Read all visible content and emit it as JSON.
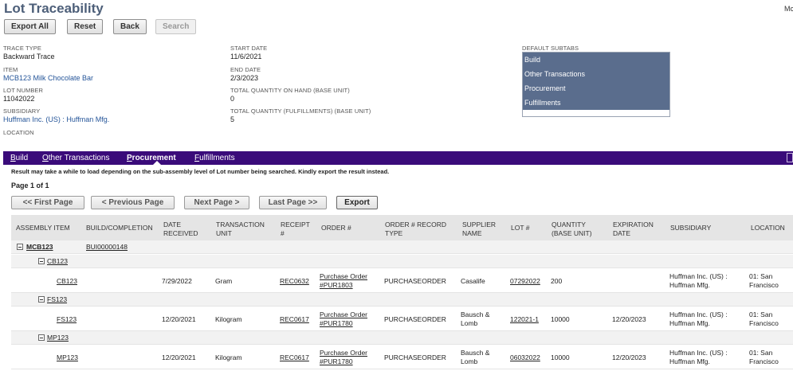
{
  "page": {
    "title": "Lot Traceability",
    "user_badge": "Mc"
  },
  "toolbar": {
    "export_all": "Export All",
    "reset": "Reset",
    "back": "Back",
    "search": "Search"
  },
  "fields": {
    "trace_type": {
      "label": "TRACE TYPE",
      "value": "Backward Trace"
    },
    "item": {
      "label": "ITEM",
      "value": "MCB123 Milk Chocolate Bar"
    },
    "lot_number": {
      "label": "LOT NUMBER",
      "value": "11042022"
    },
    "subsidiary": {
      "label": "SUBSIDIARY",
      "value": "Huffman Inc. (US) : Huffman Mfg."
    },
    "location": {
      "label": "LOCATION",
      "value": ""
    },
    "start_date": {
      "label": "START DATE",
      "value": "11/6/2021"
    },
    "end_date": {
      "label": "END DATE",
      "value": "2/3/2023"
    },
    "qty_on_hand": {
      "label": "TOTAL QUANTITY ON HAND (BASE UNIT)",
      "value": "0"
    },
    "qty_fulfillments": {
      "label": "TOTAL QUANTITY (FULFILLMENTS) (BASE UNIT)",
      "value": "5"
    }
  },
  "default_subtabs": {
    "label": "DEFAULT SUBTABS",
    "options": [
      "Build",
      "Other Transactions",
      "Procurement",
      "Fulfillments"
    ]
  },
  "tabs": [
    {
      "key": "B",
      "rest": "uild"
    },
    {
      "key": "O",
      "rest": "ther Transactions"
    },
    {
      "key": "P",
      "rest": "rocurement"
    },
    {
      "key": "F",
      "rest": "ulfillments"
    }
  ],
  "notice": "Result may take a while to load depending on the sub-assembly level of Lot number being searched. Kindly export the result instead.",
  "pagination": {
    "info": "Page 1 of 1",
    "first": "<< First Page",
    "previous": "< Previous Page",
    "next": "Next Page >",
    "last": "Last Page >>",
    "export": "Export"
  },
  "table": {
    "headers": {
      "assembly_item": "ASSEMBLY ITEM",
      "build_completion": "BUILD/COMPLETION",
      "date_received_1": "DATE",
      "date_received_2": "RECEIVED",
      "transaction_unit_1": "TRANSACTION",
      "transaction_unit_2": "UNIT",
      "receipt_1": "RECEIPT",
      "receipt_2": "#",
      "order": "ORDER #",
      "order_record_type_1": "ORDER # RECORD",
      "order_record_type_2": "TYPE",
      "supplier_name_1": "SUPPLIER",
      "supplier_name_2": "NAME",
      "lot": "LOT #",
      "quantity_1": "QUANTITY",
      "quantity_2": "(BASE UNIT)",
      "expiration_1": "EXPIRATION",
      "expiration_2": "DATE",
      "subsidiary": "SUBSIDIARY",
      "location": "LOCATION"
    },
    "top_row": {
      "assembly_item": "MCB123",
      "build_completion": "BUI00000148"
    },
    "groups": [
      {
        "name": "CB123",
        "row": {
          "item": "CB123",
          "date": "7/29/2022",
          "unit": "Gram",
          "receipt": "REC0632",
          "order_1": "Purchase Order",
          "order_2": "#PUR1803",
          "record_type": "PURCHASEORDER",
          "supplier_1": "Casalife",
          "supplier_2": "",
          "lot": "07292022",
          "quantity": "200",
          "expiration": "",
          "subsidiary_1": "Huffman Inc. (US) :",
          "subsidiary_2": "Huffman Mfg.",
          "location_1": "01: San",
          "location_2": "Francisco"
        }
      },
      {
        "name": "FS123",
        "row": {
          "item": "FS123",
          "date": "12/20/2021",
          "unit": "Kilogram",
          "receipt": "REC0617",
          "order_1": "Purchase Order",
          "order_2": "#PUR1780",
          "record_type": "PURCHASEORDER",
          "supplier_1": "Bausch &",
          "supplier_2": "Lomb",
          "lot": "122021-1",
          "quantity": "10000",
          "expiration": "12/20/2023",
          "subsidiary_1": "Huffman Inc. (US) :",
          "subsidiary_2": "Huffman Mfg.",
          "location_1": "01: San",
          "location_2": "Francisco"
        }
      },
      {
        "name": "MP123",
        "row": {
          "item": "MP123",
          "date": "12/20/2021",
          "unit": "Kilogram",
          "receipt": "REC0617",
          "order_1": "Purchase Order",
          "order_2": "#PUR1780",
          "record_type": "PURCHASEORDER",
          "supplier_1": "Bausch &",
          "supplier_2": "Lomb",
          "lot": "06032022",
          "quantity": "10000",
          "expiration": "12/20/2023",
          "subsidiary_1": "Huffman Inc. (US) :",
          "subsidiary_2": "Huffman Mfg.",
          "location_1": "01: San",
          "location_2": "Francisco"
        }
      }
    ]
  },
  "colors": {
    "title": "#4d5f79",
    "tabbar": "#3a0b7a",
    "subtab_highlight": "#5a6d8d",
    "link": "#255599"
  }
}
